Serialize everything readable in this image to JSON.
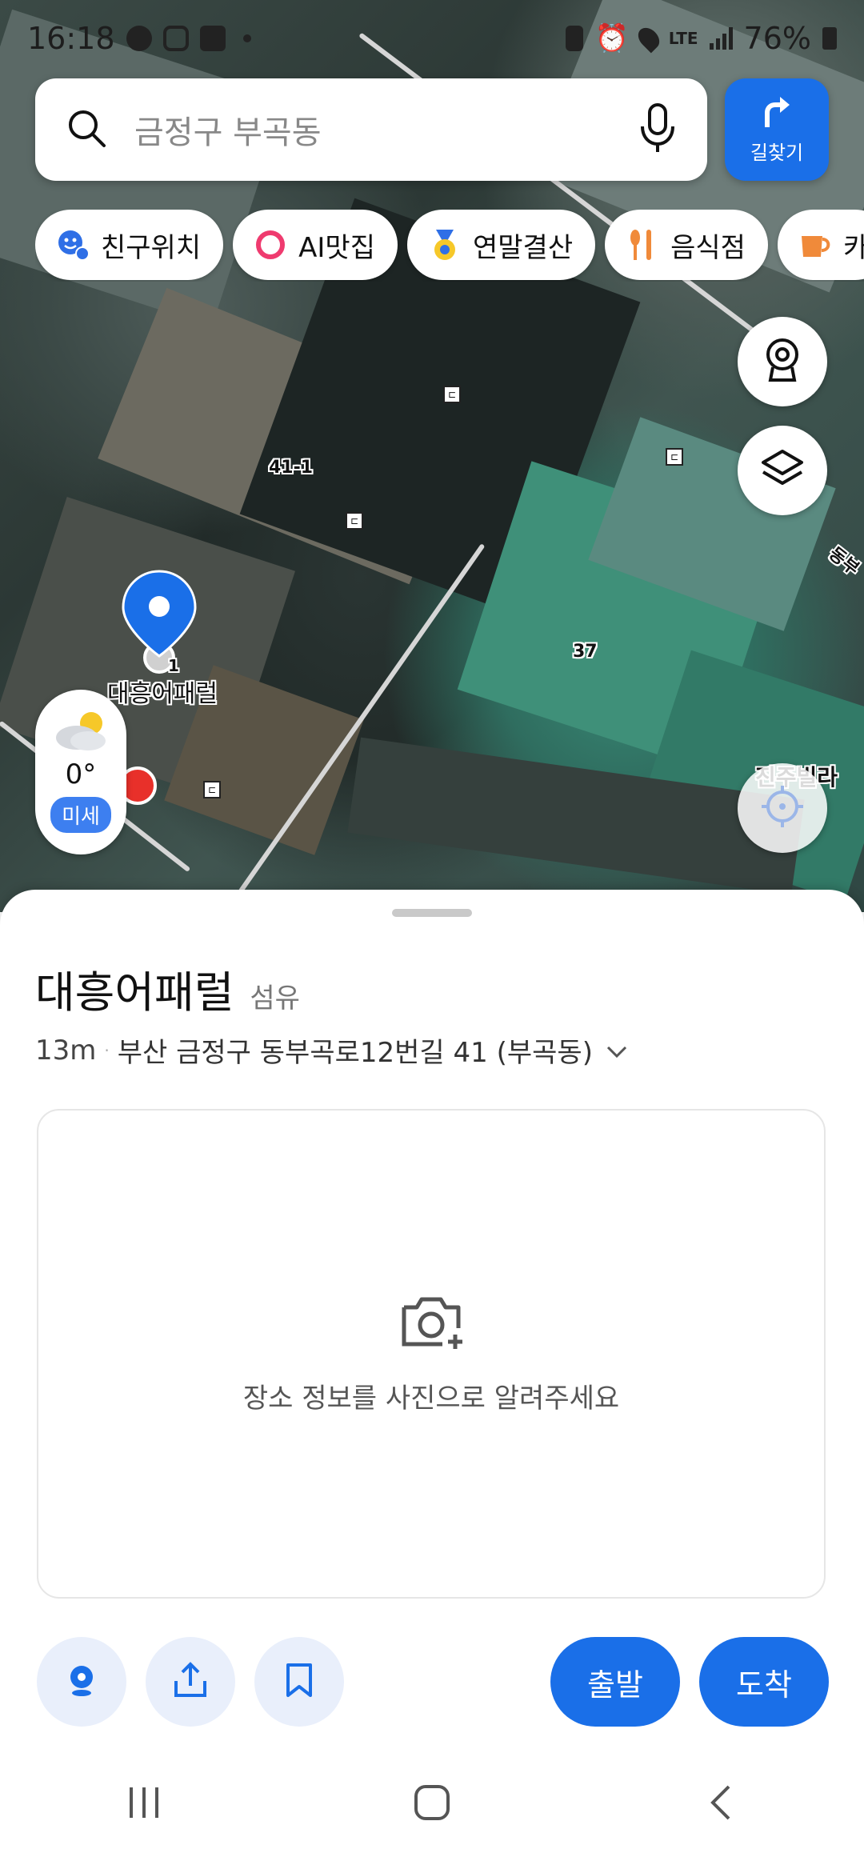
{
  "status_bar": {
    "time": "16:18",
    "network": "LTE",
    "battery": "76%"
  },
  "search": {
    "placeholder": "금정구 부곡동"
  },
  "route_button": {
    "label": "길찾기"
  },
  "chips": [
    {
      "label": "친구위치",
      "icon": "friend-location-icon"
    },
    {
      "label": "AI맛집",
      "icon": "ai-ring-icon"
    },
    {
      "label": "연말결산",
      "icon": "medal-icon"
    },
    {
      "label": "음식점",
      "icon": "fork-knife-icon"
    },
    {
      "label": "카",
      "icon": "cup-icon"
    }
  ],
  "map": {
    "labels": {
      "lot_41_1": "41-1",
      "lot_37": "37",
      "road_partial": "동부",
      "building_partial": "진주빌라",
      "pin_label": "대흥어패럴",
      "pin_sub": "1"
    }
  },
  "weather": {
    "temperature": "0°",
    "dust_label": "미세"
  },
  "place": {
    "name": "대흥어패럴",
    "category": "섬유",
    "distance": "13m",
    "separator": "·",
    "address": "부산 금정구 동부곡로12번길 41 (부곡동)"
  },
  "photo_card": {
    "message": "장소 정보를 사진으로 알려주세요"
  },
  "actions": {
    "depart_label": "출발",
    "arrive_label": "도착"
  },
  "colors": {
    "primary": "#1a6fe8",
    "action_bg": "#e9effb"
  }
}
